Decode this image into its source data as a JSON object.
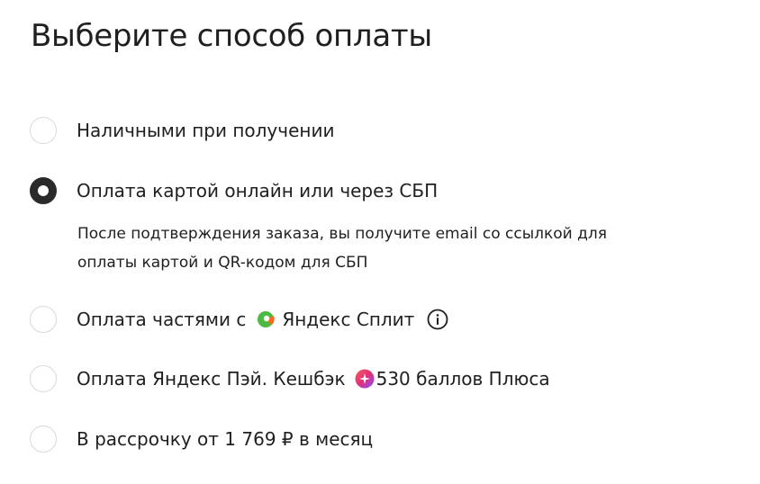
{
  "title": "Выберите способ оплаты",
  "options": [
    {
      "label": "Наличными при получении",
      "selected": false
    },
    {
      "label": "Оплата картой онлайн или через СБП",
      "selected": true,
      "description_line1": "После подтверждения заказа, вы получите email со ссылкой для",
      "description_line2": "оплаты картой и QR-кодом для СБП"
    },
    {
      "label_prefix": "Оплата частями с",
      "brand": "Яндекс Сплит",
      "selected": false,
      "icon": "yandex-split-icon",
      "info_icon": "info-icon"
    },
    {
      "label_prefix": "Оплата Яндекс Пэй. Кешбэк",
      "bonus": "530 баллов Плюса",
      "selected": false,
      "icon": "yandex-plus-icon"
    },
    {
      "label": "В рассрочку от 1 769 ₽ в месяц",
      "selected": false
    }
  ],
  "colors": {
    "text": "#1f1f1f",
    "radio_border": "#d9d9d9",
    "radio_checked": "#2b2b2b",
    "split_green": "#4cb942",
    "split_orange": "#ff6a1a",
    "plus_pink": "#e0307a"
  }
}
